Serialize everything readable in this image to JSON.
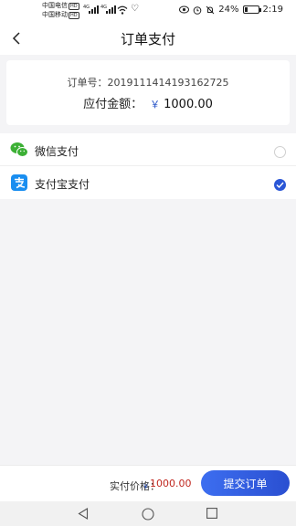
{
  "status_bar": {
    "carrier_1": "中国电信",
    "carrier_2": "中国移动",
    "hd_label": "HD",
    "net_label": "4G",
    "battery": "24%",
    "battery_level": 0.24,
    "time": "2:19"
  },
  "header": {
    "title": "订单支付"
  },
  "order": {
    "order_no": "订单号：20191114141931627 25",
    "order_no_text": "订单号：2019111414193162725",
    "amount_label": "应付金额：",
    "currency": "￥",
    "amount": "1000.00"
  },
  "payment_methods": [
    {
      "label": "微信支付",
      "icon": "wechat-icon",
      "selected": false
    },
    {
      "label": "支付宝支付",
      "icon": "alipay-icon",
      "selected": true
    }
  ],
  "bottom": {
    "price_label": "实付价格：",
    "currency": "￥",
    "price": "1000.00",
    "submit_label": "提交订单"
  },
  "colors": {
    "accent": "#2a56d6",
    "price": "#c0271f",
    "wechat": "#3cb035",
    "alipay": "#1a8ef0"
  }
}
